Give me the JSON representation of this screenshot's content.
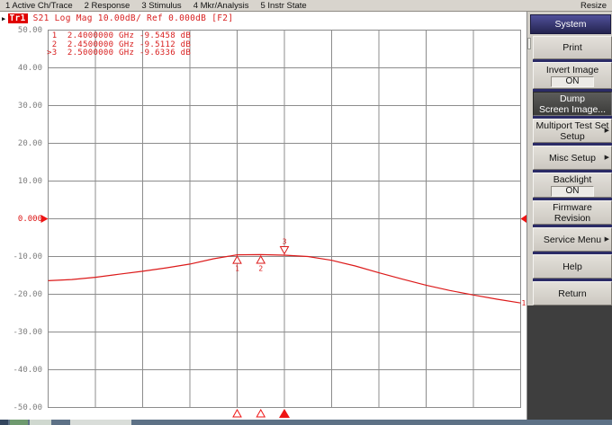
{
  "menubar": {
    "items": [
      {
        "name": "active-ch-trace",
        "label": "1 Active Ch/Trace"
      },
      {
        "name": "response",
        "label": "2 Response"
      },
      {
        "name": "stimulus",
        "label": "3 Stimulus"
      },
      {
        "name": "mkr-analysis",
        "label": "4 Mkr/Analysis"
      },
      {
        "name": "instr-state",
        "label": "5 Instr State"
      }
    ],
    "resize": "Resize"
  },
  "trace_bar": {
    "trace_id": "Tr1",
    "settings": "S21 Log Mag 10.00dB/ Ref 0.000dB [F2]"
  },
  "marker_readout": [
    {
      "prefix": "1",
      "freq": "2.4000000 GHz",
      "value": "-9.5458 dB"
    },
    {
      "prefix": "2",
      "freq": "2.4500000 GHz",
      "value": "-9.5112 dB"
    },
    {
      "prefix": ">3",
      "freq": "2.5000000 GHz",
      "value": "-9.6336 dB"
    }
  ],
  "softkeys": {
    "title": "System",
    "buttons": [
      {
        "name": "print",
        "lines": [
          "Print"
        ]
      },
      {
        "name": "invert-image",
        "lines": [
          "Invert Image"
        ],
        "value": "ON"
      },
      {
        "name": "dump-screen-image",
        "lines": [
          "Dump",
          "Screen Image..."
        ],
        "selected": true
      },
      {
        "name": "multiport-test-set-setup",
        "lines": [
          "Multiport Test Set",
          "Setup"
        ],
        "arrow": true
      },
      {
        "name": "misc-setup",
        "lines": [
          "Misc Setup"
        ],
        "arrow": true
      },
      {
        "name": "backlight",
        "lines": [
          "Backlight"
        ],
        "value": "ON"
      },
      {
        "name": "firmware-revision",
        "lines": [
          "Firmware",
          "Revision"
        ]
      },
      {
        "name": "service-menu",
        "lines": [
          "Service Menu"
        ],
        "arrow": true
      },
      {
        "name": "help",
        "lines": [
          "Help"
        ]
      },
      {
        "name": "return",
        "lines": [
          "Return"
        ]
      }
    ]
  },
  "chart_data": {
    "type": "line",
    "y_axis_labels": [
      "50.00",
      "40.00",
      "30.00",
      "20.00",
      "10.00",
      "0.000",
      "-10.00",
      "-20.00",
      "-30.00",
      "-40.00",
      "-50.00"
    ],
    "ylim_db": [
      -50,
      50
    ],
    "db_per_division": 10,
    "ref_level_db": 0,
    "xlim_ghz": [
      2.0,
      3.0
    ],
    "grid_divisions": {
      "x": 10,
      "y": 10
    },
    "series": [
      {
        "name": "Tr1 S21 Log Mag",
        "x_ghz": [
          2.0,
          2.05,
          2.1,
          2.15,
          2.2,
          2.25,
          2.3,
          2.35,
          2.4,
          2.45,
          2.5,
          2.55,
          2.6,
          2.65,
          2.7,
          2.75,
          2.8,
          2.85,
          2.9,
          2.95,
          3.0
        ],
        "db": [
          -16.4,
          -16.1,
          -15.5,
          -14.7,
          -13.9,
          -13.0,
          -12.0,
          -10.6,
          -9.5458,
          -9.5112,
          -9.6336,
          -10.0,
          -11.0,
          -12.5,
          -14.3,
          -16.0,
          -17.6,
          -19.0,
          -20.2,
          -21.3,
          -22.3
        ]
      }
    ],
    "markers": [
      {
        "n": "1",
        "freq_ghz": 2.4,
        "db": -9.5458,
        "active": false
      },
      {
        "n": "2",
        "freq_ghz": 2.45,
        "db": -9.5112,
        "active": false
      },
      {
        "n": "3",
        "freq_ghz": 2.5,
        "db": -9.6336,
        "active": true
      }
    ],
    "trace_end_label": "1"
  },
  "colors": {
    "accent_red": "#dc1a1a",
    "grid_gray": "#8c8c8c",
    "navy_separator": "#2b2b66",
    "button_face": "#d2cfc8",
    "selected_key": "#4a4a48",
    "dead_panel": "#3e3e3e",
    "taskbar": "#5d7186"
  }
}
